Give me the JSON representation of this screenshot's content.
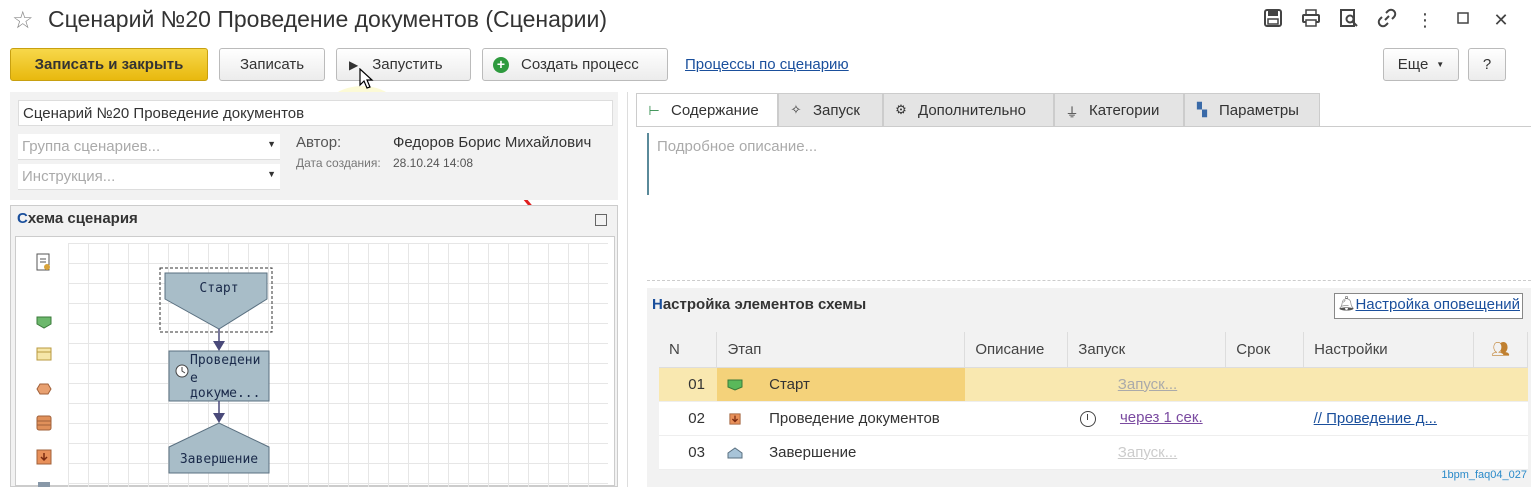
{
  "window": {
    "title": "Сценарий №20 Проведение документов (Сценарии)"
  },
  "toolbar": {
    "save_close": "Записать и закрыть",
    "save": "Записать",
    "run": "Запустить",
    "create_process": "Создать процесс",
    "processes_link": "Процессы по сценарию",
    "more": "Еще",
    "help": "?"
  },
  "header": {
    "name": "Сценарий №20 Проведение документов",
    "group_placeholder": "Группа сценариев...",
    "instruction_placeholder": "Инструкция...",
    "author_label": "Автор:",
    "author_value": "Федоров Борис Михайлович",
    "date_label": "Дата создания:",
    "date_value": "28.10.24 14:08"
  },
  "schema": {
    "title_first": "С",
    "title_rest": "хема сценария",
    "nodes": {
      "start": "Старт",
      "doc_line1": "Проведени",
      "doc_line2": "е докуме...",
      "end": "Завершение"
    }
  },
  "tabs": [
    {
      "label": "Содержание",
      "icon": "tree-icon"
    },
    {
      "label": "Запуск",
      "icon": "wand-icon"
    },
    {
      "label": "Дополнительно",
      "icon": "gear-icon"
    },
    {
      "label": "Категории",
      "icon": "funnel-icon"
    },
    {
      "label": "Параметры",
      "icon": "blocks-icon"
    }
  ],
  "content": {
    "description_placeholder": "Подробное описание..."
  },
  "settings": {
    "title_first": "Н",
    "title_rest": "астройка элементов схемы",
    "notify_button": "Настройка оповещений",
    "columns": [
      "N",
      "Этап",
      "Описание",
      "Запуск",
      "Срок",
      "Настройки"
    ],
    "rows": [
      {
        "n": "01",
        "stage": "Старт",
        "description": "",
        "launch": "Запуск...",
        "term": "",
        "settings": ""
      },
      {
        "n": "02",
        "stage": "Проведение документов",
        "description": "",
        "launch": "через 1 сек.",
        "term": "",
        "settings": "// Проведение д..."
      },
      {
        "n": "03",
        "stage": "Завершение",
        "description": "",
        "launch": "Запуск...",
        "term": "",
        "settings": ""
      }
    ]
  },
  "colors": {
    "accent": "#e8b90e",
    "link": "#1a4f9c",
    "selected_row": "#f9e8b0",
    "node_fill": "#a8bdc8"
  },
  "watermark": "1bpm_faq04_027"
}
